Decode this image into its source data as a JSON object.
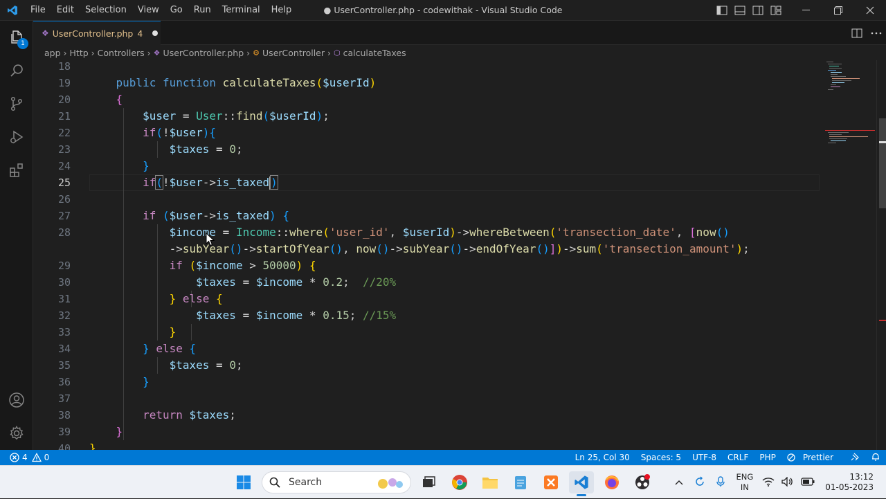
{
  "titlebar": {
    "menu": [
      "File",
      "Edit",
      "Selection",
      "View",
      "Go",
      "Run",
      "Terminal",
      "Help"
    ],
    "title": "● UserController.php - codewithak - Visual Studio Code"
  },
  "activity": {
    "explorer_badge": "1"
  },
  "tab": {
    "name": "UserController.php",
    "problems": "4"
  },
  "breadcrumb": {
    "parts": [
      "app",
      "Http",
      "Controllers",
      "UserController.php",
      "UserController",
      "calculateTaxes"
    ]
  },
  "editor": {
    "line_numbers": [
      "18",
      "19",
      "20",
      "21",
      "22",
      "23",
      "24",
      "25",
      "26",
      "27",
      "28",
      "",
      "29",
      "30",
      "31",
      "32",
      "33",
      "34",
      "35",
      "36",
      "37",
      "38",
      "39",
      "40"
    ],
    "current_line": "25",
    "comments": {
      "rate_high": "//20%",
      "rate_low": "//15%"
    },
    "strings": {
      "user_id": "'user_id'",
      "date": "'transection_date'",
      "amount": "'transection_amount'"
    },
    "numbers": {
      "threshold": "50000",
      "high": "0.2",
      "low": "0.15",
      "zero": "0"
    }
  },
  "statusbar": {
    "problems_errors": "4",
    "problems_warnings": "0",
    "position": "Ln 25, Col 30",
    "spaces": "Spaces: 5",
    "encoding": "UTF-8",
    "eol": "CRLF",
    "language": "PHP",
    "formatter": "Prettier"
  },
  "taskbar": {
    "search_placeholder": "Search",
    "lang_line1": "ENG",
    "lang_line2": "IN",
    "time": "13:12",
    "date": "01-05-2023"
  },
  "colors": {
    "accent": "#0078d4",
    "editor_bg": "#1f1f1f",
    "keyword": "#569cd6",
    "control": "#c586c0",
    "function": "#dcdcaa",
    "variable": "#9cdcfe",
    "class": "#4ec9b0",
    "string": "#ce9178",
    "comment": "#6a9955"
  }
}
